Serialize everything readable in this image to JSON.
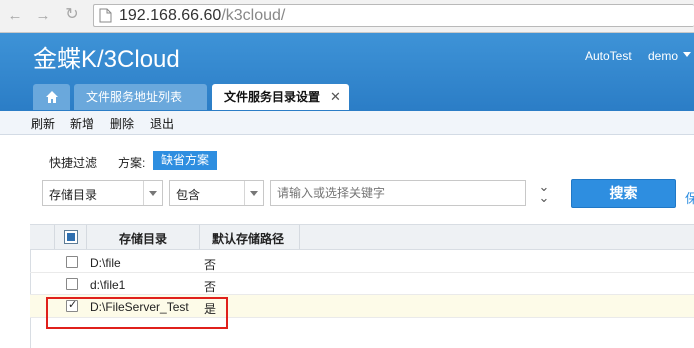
{
  "browser": {
    "url_host": "192.168.66.60",
    "url_path": "/k3cloud/"
  },
  "header": {
    "logo_main": "金蝶K/3",
    "logo_cloud": "Cloud",
    "tenant": "AutoTest",
    "user": "demo"
  },
  "tabs": [
    {
      "label": "文件服务地址列表"
    },
    {
      "label": "文件服务目录设置"
    }
  ],
  "toolbar": {
    "refresh": "刷新",
    "add": "新增",
    "delete": "删除",
    "exit": "退出"
  },
  "filter": {
    "quick_filter_label": "快捷过滤",
    "scheme_label": "方案:",
    "scheme_value": "缺省方案",
    "field_value": "存储目录",
    "operator_value": "包含",
    "search_placeholder": "请输入或选择关键字",
    "search_button": "搜索",
    "save_link": "保"
  },
  "grid": {
    "columns": [
      "存储目录",
      "默认存储路径"
    ],
    "rows": [
      {
        "dir": "D:\\file",
        "default": "否",
        "checked": false
      },
      {
        "dir": "d:\\file1",
        "default": "否",
        "checked": false
      },
      {
        "dir": "D:\\FileServer_Test",
        "default": "是",
        "checked": true
      }
    ]
  },
  "colors": {
    "header_blue": "#2b7dc6",
    "accent_blue": "#2e8ee0",
    "highlight_red": "#e0201b"
  }
}
